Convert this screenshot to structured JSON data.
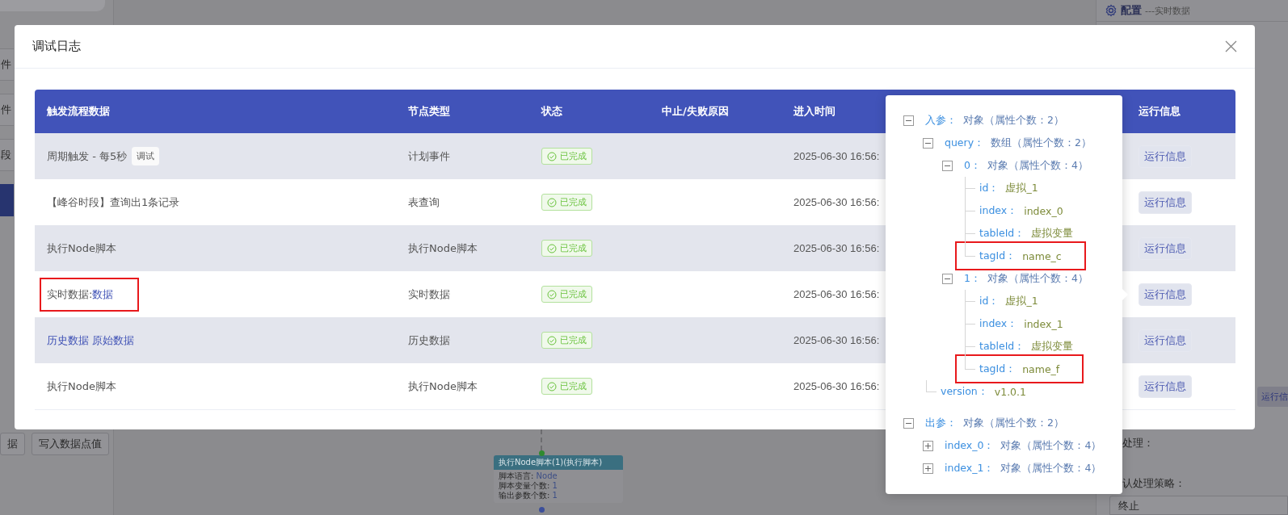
{
  "backdrop": {
    "sidebar_items": [
      {
        "label": "件",
        "selected": false
      },
      {
        "label": "件",
        "selected": false
      },
      {
        "label": "段",
        "selected": false
      },
      {
        "selected": true
      }
    ],
    "sidebar_buttons": [
      "据",
      "写入数据点值"
    ],
    "right_panel": {
      "title": "配置",
      "subtitle": "---实时数据",
      "button": "运行信",
      "labels": [
        "处理：",
        "认处理策略："
      ],
      "select_value": "终止"
    },
    "canvas_node": {
      "title": "执行Node脚本(1)(执行脚本)",
      "lines": [
        {
          "label": "脚本语言: ",
          "value": "Node"
        },
        {
          "label": "脚本变量个数: ",
          "value": "1"
        },
        {
          "label": "输出参数个数: ",
          "value": "1"
        }
      ]
    }
  },
  "dialog": {
    "title": "调试日志",
    "columns": [
      "触发流程数据",
      "节点类型",
      "状态",
      "中止/失败原因",
      "进入时间",
      "运行信息"
    ],
    "rows": [
      {
        "trigger": [
          {
            "kind": "text",
            "text": "周期触发 - 每5秒"
          },
          {
            "kind": "tag",
            "text": "调试"
          }
        ],
        "highlighted": false,
        "node_type": "计划事件",
        "status": {
          "kind": "success",
          "label": "已完成"
        },
        "time": "2025-06-30 16:56:",
        "action": "运行信息"
      },
      {
        "trigger": [
          {
            "kind": "text",
            "text": "【峰谷时段】查询出1条记录"
          }
        ],
        "highlighted": false,
        "node_type": "表查询",
        "status": {
          "kind": "success",
          "label": "已完成"
        },
        "time": "2025-06-30 16:56:",
        "action": "运行信息"
      },
      {
        "trigger": [
          {
            "kind": "text",
            "text": "执行Node脚本"
          }
        ],
        "highlighted": false,
        "node_type": "执行Node脚本",
        "status": {
          "kind": "success",
          "label": "已完成"
        },
        "time": "2025-06-30 16:56:",
        "action": "运行信息"
      },
      {
        "trigger": [
          {
            "kind": "text",
            "text": "实时数据: "
          },
          {
            "kind": "link",
            "text": "数据"
          }
        ],
        "highlighted": true,
        "node_type": "实时数据",
        "status": {
          "kind": "success",
          "label": "已完成"
        },
        "time": "2025-06-30 16:56:",
        "action": "运行信息"
      },
      {
        "trigger": [
          {
            "kind": "link",
            "text": "历史数据 原始数据"
          }
        ],
        "highlighted": false,
        "node_type": "历史数据",
        "status": {
          "kind": "success",
          "label": "已完成"
        },
        "time": "2025-06-30 16:56:",
        "action": "运行信息"
      },
      {
        "trigger": [
          {
            "kind": "text",
            "text": "执行Node脚本"
          }
        ],
        "highlighted": false,
        "node_type": "执行Node脚本",
        "status": {
          "kind": "success",
          "label": "已完成"
        },
        "time": "2025-06-30 16:56:",
        "action": "运行信息"
      }
    ]
  },
  "popover": {
    "tree": [
      {
        "key": "入参：",
        "value": "对象（属性个数：2）",
        "expanded": true,
        "highlighted": false,
        "children": [
          {
            "key": "query：",
            "value": "数组（属性个数：2）",
            "expanded": true,
            "highlighted": false,
            "children": [
              {
                "key": "0：",
                "value": "对象（属性个数：4）",
                "expanded": true,
                "highlighted": false,
                "children": [
                  {
                    "key": "id：",
                    "value": "虚拟_1",
                    "highlighted": false
                  },
                  {
                    "key": "index：",
                    "value": "index_0",
                    "highlighted": false
                  },
                  {
                    "key": "tableId：",
                    "value": "虚拟变量",
                    "highlighted": false
                  },
                  {
                    "key": "tagId：",
                    "value": "name_c",
                    "highlighted": true
                  }
                ]
              },
              {
                "key": "1：",
                "value": "对象（属性个数：4）",
                "expanded": true,
                "highlighted": false,
                "children": [
                  {
                    "key": "id：",
                    "value": "虚拟_1",
                    "highlighted": false
                  },
                  {
                    "key": "index：",
                    "value": "index_1",
                    "highlighted": false
                  },
                  {
                    "key": "tableId：",
                    "value": "虚拟变量",
                    "highlighted": false
                  },
                  {
                    "key": "tagId：",
                    "value": "name_f",
                    "highlighted": true
                  }
                ]
              }
            ]
          },
          {
            "key": "version：",
            "value": "v1.0.1",
            "highlighted": false
          }
        ]
      },
      {
        "key": "出参：",
        "value": "对象（属性个数：2）",
        "expanded": true,
        "highlighted": false,
        "children": [
          {
            "key": "index_0：",
            "value": "对象（属性个数：4）",
            "expanded": false,
            "highlighted": false
          },
          {
            "key": "index_1：",
            "value": "对象（属性个数：4）",
            "expanded": false,
            "highlighted": false
          }
        ]
      }
    ]
  }
}
